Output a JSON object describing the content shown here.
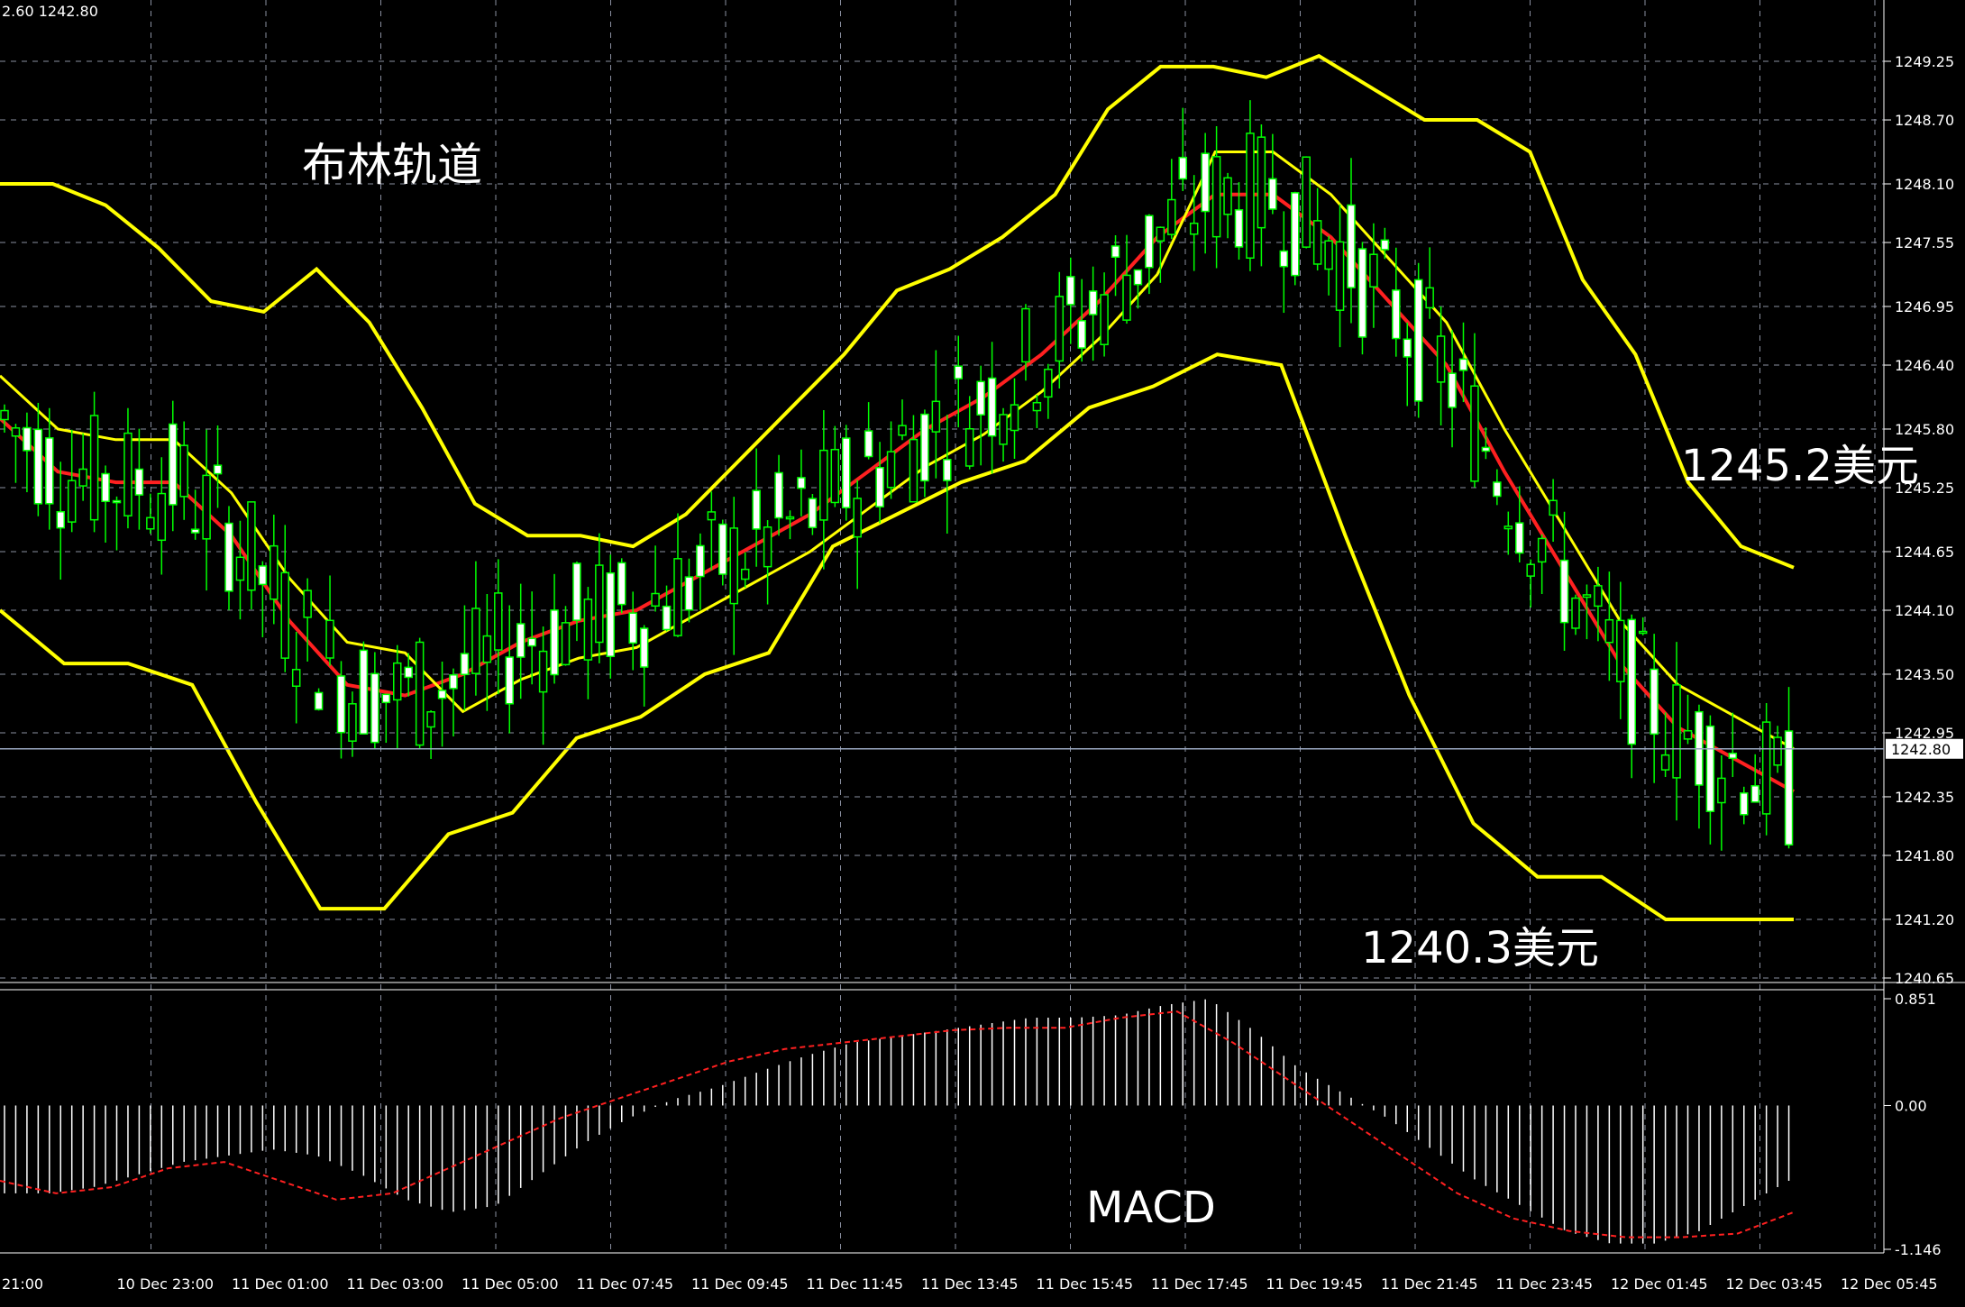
{
  "header": {
    "text": "2.60 1242.80"
  },
  "annotations": {
    "bollinger": "布林轨道",
    "upper_level": "1245.2美元",
    "lower_level": "1240.3美元",
    "macd": "MACD"
  },
  "chart_data": [
    {
      "type": "candlestick",
      "title": "",
      "indicator": "Bollinger Bands",
      "ylim": [
        1240.65,
        1249.25
      ],
      "y_ticks": [
        "1249.25",
        "1248.70",
        "1248.10",
        "1247.55",
        "1246.95",
        "1246.40",
        "1245.80",
        "1245.25",
        "1244.65",
        "1244.10",
        "1243.50",
        "1242.95",
        "1242.35",
        "1241.80",
        "1241.20",
        "1240.65"
      ],
      "current_price": "1242.80",
      "x_ticks": [
        "21:00",
        "10 Dec 23:00",
        "11 Dec 01:00",
        "11 Dec 03:00",
        "11 Dec 05:00",
        "11 Dec 07:45",
        "11 Dec 09:45",
        "11 Dec 11:45",
        "11 Dec 13:45",
        "11 Dec 15:45",
        "11 Dec 17:45",
        "11 Dec 19:45",
        "11 Dec 21:45",
        "11 Dec 23:45",
        "12 Dec 01:45",
        "12 Dec 03:45",
        "12 Dec 05:45"
      ],
      "bands": {
        "upper": [
          1248.1,
          1248.1,
          1247.9,
          1247.5,
          1247.0,
          1246.9,
          1247.3,
          1246.8,
          1246.0,
          1245.1,
          1244.8,
          1244.8,
          1244.7,
          1245.0,
          1245.5,
          1246.0,
          1246.5,
          1247.1,
          1247.3,
          1247.6,
          1248.0,
          1248.8,
          1249.2,
          1249.2,
          1249.1,
          1249.3,
          1249.0,
          1248.7,
          1248.7,
          1248.4,
          1247.2,
          1246.5,
          1245.3,
          1244.7,
          1244.5
        ],
        "middle": [
          1245.9,
          1245.4,
          1245.3,
          1245.3,
          1244.8,
          1244.0,
          1243.4,
          1243.3,
          1243.5,
          1243.8,
          1244.0,
          1244.1,
          1244.4,
          1244.7,
          1245.0,
          1245.4,
          1245.8,
          1246.1,
          1246.5,
          1247.0,
          1247.6,
          1248.0,
          1248.0,
          1247.6,
          1247.0,
          1246.4,
          1245.4,
          1244.5,
          1243.6,
          1243.0,
          1242.7,
          1242.4
        ],
        "lower": [
          1244.1,
          1243.6,
          1243.6,
          1243.4,
          1242.3,
          1241.3,
          1241.3,
          1242.0,
          1242.2,
          1242.9,
          1243.1,
          1243.5,
          1243.7,
          1244.7,
          1245.0,
          1245.3,
          1245.5,
          1246.0,
          1246.2,
          1246.5,
          1246.4,
          1244.8,
          1243.3,
          1242.1,
          1241.6,
          1241.6,
          1241.2,
          1241.2,
          1241.2
        ]
      },
      "candles_summary": "rise from 1242.0 (11 Dec 03:00) to 1249.0 (11 Dec 17:45), fall to 1241.2 (12 Dec 01:45), close 1242.80"
    },
    {
      "type": "histogram",
      "title": "MACD",
      "ylim": [
        -1.146,
        0.851
      ],
      "y_ticks": [
        "0.851",
        "0.00",
        "-1.146"
      ],
      "histogram_values": [
        -0.7,
        -0.7,
        -0.65,
        -0.55,
        -0.45,
        -0.4,
        -0.35,
        -0.4,
        -0.55,
        -0.75,
        -0.85,
        -0.8,
        -0.55,
        -0.3,
        -0.1,
        0.05,
        0.15,
        0.28,
        0.4,
        0.5,
        0.55,
        0.6,
        0.65,
        0.7,
        0.7,
        0.72,
        0.8,
        0.85,
        0.6,
        0.3,
        0.1,
        -0.1,
        -0.35,
        -0.6,
        -0.8,
        -1.0,
        -1.1,
        -1.1,
        -1.0,
        -0.8,
        -0.6
      ],
      "signal_values": [
        -0.6,
        -0.7,
        -0.65,
        -0.5,
        -0.45,
        -0.6,
        -0.75,
        -0.7,
        -0.5,
        -0.3,
        -0.1,
        0.05,
        0.2,
        0.35,
        0.45,
        0.5,
        0.55,
        0.6,
        0.62,
        0.62,
        0.7,
        0.75,
        0.5,
        0.2,
        -0.1,
        -0.4,
        -0.7,
        -0.9,
        -1.0,
        -1.05,
        -1.05,
        -1.02,
        -0.85
      ]
    }
  ]
}
